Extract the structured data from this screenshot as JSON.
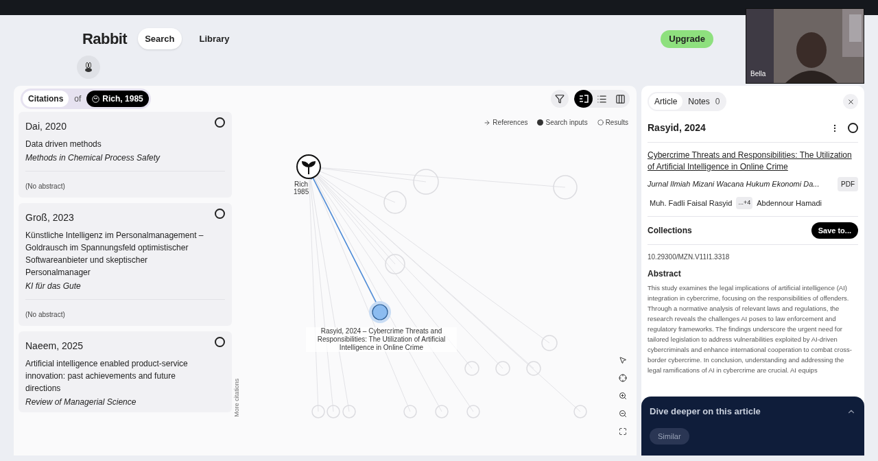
{
  "header": {
    "logo_text": "Rabbit",
    "nav": [
      {
        "label": "Search",
        "selected": true
      },
      {
        "label": "Library",
        "selected": false
      }
    ],
    "upgrade": "Upgrade"
  },
  "video_tile": {
    "name": "Bella"
  },
  "toolbar": {
    "mode": "Citations",
    "connector": "of",
    "seed": "Rich, 1985",
    "views": [
      {
        "kind": "graph",
        "selected": true
      },
      {
        "kind": "list",
        "selected": false
      },
      {
        "kind": "columns",
        "selected": false
      }
    ]
  },
  "papers": [
    {
      "heading": "Dai, 2020",
      "title": "Data driven methods",
      "journal": "Methods in Chemical Process Safety",
      "abstract": "(No abstract)",
      "selected": false
    },
    {
      "heading": "Groß, 2023",
      "title": "Künstliche Intelligenz im Personalmanagement – Goldrausch im Spannungsfeld optimistischer Softwareanbieter und skeptischer Personalmanager",
      "journal": "KI für das Gute",
      "abstract": "(No abstract)",
      "selected": false
    },
    {
      "heading": "Naeem, 2025",
      "title": "Artificial intelligence enabled product-service innovation: past achievements and future directions",
      "journal": "Review of Managerial Science",
      "selected": false
    }
  ],
  "graph": {
    "legend": [
      {
        "kind": "references",
        "label": "References"
      },
      {
        "kind": "search",
        "label": "Search inputs"
      },
      {
        "kind": "results",
        "label": "Results"
      }
    ],
    "seed_label": [
      "Rich",
      "1985"
    ],
    "selected_label": "Rasyid, 2024 – Cybercrime Threats and Responsibilities: The Utilization of Artificial Intelligence in Online Crime",
    "more_citations": "More citations"
  },
  "article": {
    "tabs": [
      {
        "label": "Article",
        "selected": true
      },
      {
        "label": "Notes",
        "count": "0",
        "selected": false
      }
    ],
    "heading": "Rasyid, 2024",
    "selected": false,
    "title": "Cybercrime Threats and Responsibilities: The Utilization of Artificial Intelligence in Online Crime",
    "journal": "Jurnal Ilmiah Mizani Wacana Hukum Ekonomi Da...",
    "pdf": "PDF",
    "authors": [
      "Muh. Fadli Faisal Rasyid",
      "Abdennour Hamadi"
    ],
    "more_authors": "...+4",
    "collections": "Collections",
    "save": "Save to...",
    "doi": "10.29300/MZN.V11I1.3318",
    "abstract_heading": "Abstract",
    "abstract": "This study examines the legal implications of artificial intelligence (AI) integration in cybercrime, focusing on the responsibilities of offenders. Through a normative analysis of relevant laws and regulations, the research reveals the challenges AI poses to law enforcement and regulatory frameworks. The findings underscore the urgent need for tailored legislation to address vulnerabilities exploited by AI-driven cybercriminals and enhance international cooperation to combat cross-border cybercrime. In conclusion, understanding and addressing the legal ramifications of AI in cybercrime are crucial. AI equips",
    "dive": {
      "title": "Dive deeper on this article",
      "expanded": true,
      "button": "Similar"
    }
  }
}
